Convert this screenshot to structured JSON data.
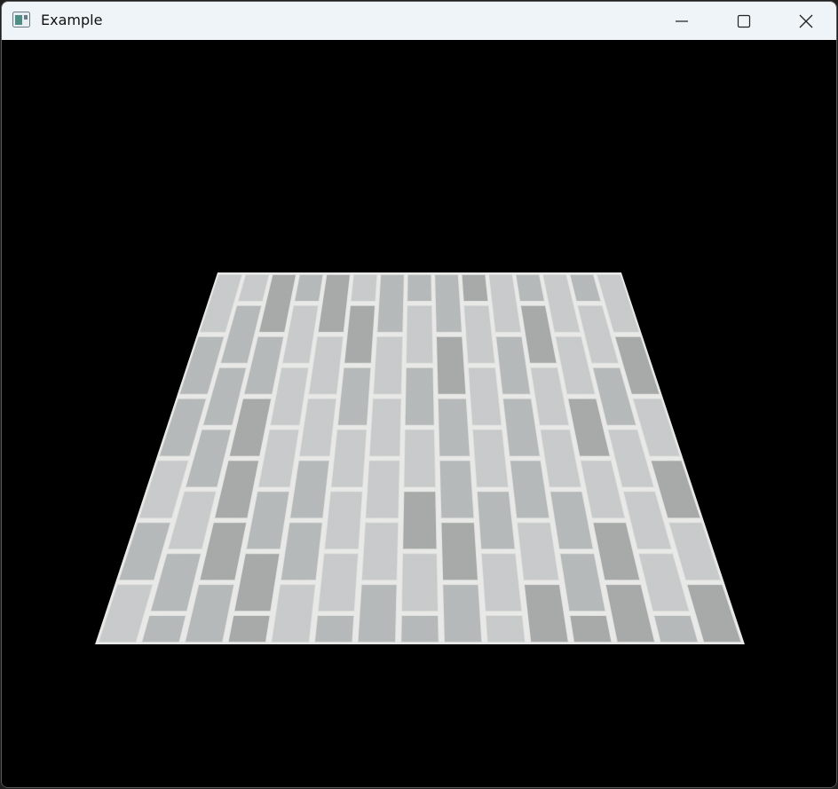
{
  "window": {
    "title": "Example",
    "icons": {
      "app": "app-window-icon",
      "minimize": "minimize-icon",
      "maximize": "maximize-icon",
      "close": "close-icon"
    }
  },
  "viewport": {
    "background_color": "#000000",
    "content": "stone-brick-floor-plane",
    "colors": {
      "brick_light": "#c8cbcb",
      "brick_mid": "#b4b8b8",
      "brick_dark": "#a4a7a6",
      "mortar": "#ececea"
    }
  }
}
